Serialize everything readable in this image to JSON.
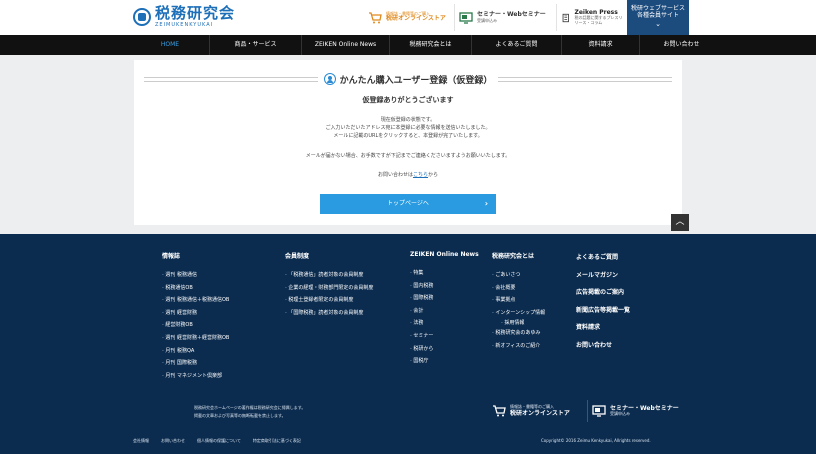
{
  "header": {
    "logo_title": "税務研究会",
    "logo_sub": "ZEIMUKENKYUKAI",
    "store_small": "情報誌・書籍等のご購入",
    "store_big": "税研オンラインストア",
    "seminar_big": "セミナー・Webセミナー",
    "seminar_small": "受講申込み",
    "press_big": "Zeiken Press",
    "press_small": "税の話題に関するプレスリリース・コラム",
    "member_line1": "税研ウェブサービス",
    "member_line2": "各種会員サイト",
    "member_chev": "⌄"
  },
  "nav": {
    "items": [
      "HOME",
      "商品・サービス",
      "ZEIKEN Online News",
      "税務研究会とは",
      "よくあるご質問",
      "資料請求",
      "お問い合わせ"
    ]
  },
  "main": {
    "title": "かんたん購入ユーザー登録（仮登録）",
    "subtitle": "仮登録ありがとうございます",
    "line1": "現在仮登録の状態です。",
    "line2": "ご入力いただいたアドレス宛に本登録に必要な情報を送信いたしました。",
    "line3": "メールに記載のURLをクリックすると、本登録が完了いたします。",
    "line4": "メールが届かない場合、お手数ですが下記までご連絡くださいますようお願いいたします。",
    "contact_prefix": "お問い合わせは",
    "contact_link": "こちら",
    "contact_suffix": "から",
    "top_button": "トップページへ",
    "top_button_arrow": "›",
    "pagetop_glyph": "︿"
  },
  "footer": {
    "col1": {
      "head": "情報誌",
      "items": [
        "週刊 税務通信",
        "税務通信OB",
        "週刊 税務通信＋税務通信OB",
        "週刊 経営財務",
        "経営財務OB",
        "週刊 経営財務＋経営財務OB",
        "月刊 税務QA",
        "月刊 国際税務",
        "月刊 マネジメント倶楽部"
      ]
    },
    "col2": {
      "head": "会員制度",
      "items": [
        "「税務通信」読者対象の会員制度",
        "企業の経理・財務部門限定の会員制度",
        "税理士登録者限定の会員制度",
        "「国際税務」読者対象の会員制度"
      ]
    },
    "col3": {
      "head": "ZEIKEN Online News",
      "items": [
        "特集",
        "国内税務",
        "国際税務",
        "会計",
        "法務",
        "セミナー",
        "税研から",
        "国税庁"
      ]
    },
    "col4": {
      "head": "税務研究会とは",
      "items": [
        "ごあいさつ",
        "会社概要",
        "事業拠点",
        "インターンシップ情報",
        "採用情報",
        "税務研究会のあゆみ",
        "新オフィスのご紹介"
      ]
    },
    "col5": [
      "よくあるご質問",
      "メールマガジン",
      "広告掲載のご案内",
      "新聞広告等掲載一覧",
      "資料請求",
      "お問い合わせ"
    ],
    "note1": "税務研究会ホームページの著作権は税務研究会に帰属します。",
    "note2": "掲載の文章および写真等の無断転載を禁止します。",
    "store_small": "情報誌・書籍等のご購入",
    "store_big": "税研オンラインストア",
    "seminar_big": "セミナー・Webセミナー",
    "seminar_small": "受講申込み",
    "links": [
      "会社情報",
      "お問い合わせ",
      "個人情報の保護について",
      "特定商取引法に基づく表記"
    ],
    "copyright": "Copyright© 2016 Zeimu Kenkyukai, Allrights reserved."
  }
}
